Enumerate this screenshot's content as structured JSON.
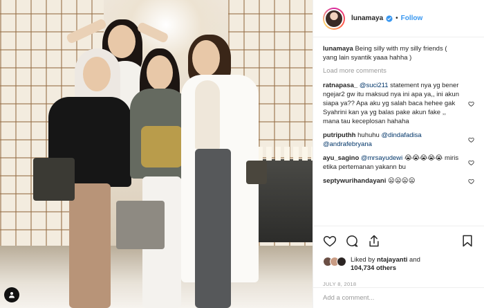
{
  "post": {
    "username": "lunamaya",
    "verified": true,
    "follow_label": "Follow",
    "caption": {
      "user": "lunamaya",
      "text": "Being silly with my silly friends ( yang lain syantik yaaa hahha )"
    },
    "load_more_label": "Load more comments",
    "comments": [
      {
        "user": "ratnapasa_",
        "mention": "@suci211",
        "text": " statement nya yg bener ngejar2 gw itu maksud nya ini apa ya,, ini akun siapa ya?? Apa aku yg salah baca hehee gak Syahrini kan ya yg balas pake akun fake ,, mana tau keceplosan hahaha"
      },
      {
        "user": "putriputhh",
        "text": "huhuhu ",
        "mention": "@dindafadisa",
        "text2": " ",
        "mention2": "@andrafebryana"
      },
      {
        "user": "ayu_sagino",
        "mention": "@mrsayudewi",
        "text": " 😭😭😭😭😭 miris etika pertemanan yakann bu"
      },
      {
        "user": "septywurihandayani",
        "text": "😦😦😦😦"
      }
    ],
    "likes": {
      "prefix": "Liked by ",
      "user": "ntajayanti",
      "middle": " and",
      "count": "104,734 others"
    },
    "date": "JULY 8, 2018",
    "add_comment_placeholder": "Add a comment..."
  },
  "colors": {
    "link": "#3897f0",
    "mention": "#003569",
    "muted": "#999999",
    "border": "#efefef"
  },
  "icons": [
    "verified-badge-icon",
    "heart-icon",
    "like-icon",
    "comment-icon",
    "share-icon",
    "bookmark-icon",
    "user-icon"
  ]
}
